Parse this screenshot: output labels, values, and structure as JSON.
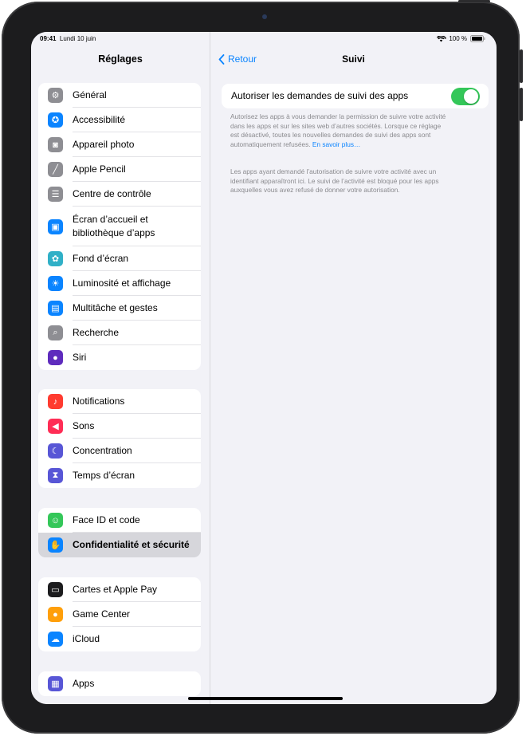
{
  "status": {
    "time": "09:41",
    "date": "Lundi 10 juin",
    "battery": "100 %"
  },
  "sidebar": {
    "title": "Réglages",
    "groups": [
      [
        {
          "label": "Général",
          "icon": "gear-icon",
          "color": "#8e8e93"
        },
        {
          "label": "Accessibilité",
          "icon": "accessibility-icon",
          "color": "#0a84ff"
        },
        {
          "label": "Appareil photo",
          "icon": "camera-icon",
          "color": "#8e8e93"
        },
        {
          "label": "Apple Pencil",
          "icon": "pencil-icon",
          "color": "#8e8e93"
        },
        {
          "label": "Centre de contrôle",
          "icon": "toggles-icon",
          "color": "#8e8e93"
        },
        {
          "label_line1": "Écran d’accueil et",
          "label_line2": "bibliothèque d’apps",
          "icon": "home-screen-icon",
          "color": "#0a84ff"
        },
        {
          "label": "Fond d’écran",
          "icon": "flower-icon",
          "color": "#30b0c7"
        },
        {
          "label": "Luminosité et affichage",
          "icon": "sun-icon",
          "color": "#0a84ff"
        },
        {
          "label": "Multitâche et gestes",
          "icon": "multitask-icon",
          "color": "#0a84ff"
        },
        {
          "label": "Recherche",
          "icon": "search-icon",
          "color": "#8e8e93"
        },
        {
          "label": "Siri",
          "icon": "siri-icon",
          "color": "#5e2bbd"
        }
      ],
      [
        {
          "label": "Notifications",
          "icon": "bell-icon",
          "color": "#ff3b30"
        },
        {
          "label": "Sons",
          "icon": "speaker-icon",
          "color": "#ff2d55"
        },
        {
          "label": "Concentration",
          "icon": "moon-icon",
          "color": "#5856d6"
        },
        {
          "label": "Temps d’écran",
          "icon": "hourglass-icon",
          "color": "#5856d6"
        }
      ],
      [
        {
          "label": "Face ID et code",
          "icon": "faceid-icon",
          "color": "#34c759"
        },
        {
          "label": "Confidentialité et sécurité",
          "icon": "hand-icon",
          "color": "#0a84ff",
          "selected": true
        }
      ],
      [
        {
          "label": "Cartes et Apple Pay",
          "icon": "wallet-icon",
          "color": "#1c1c1e"
        },
        {
          "label": "Game Center",
          "icon": "game-center-icon",
          "color": "#ff9f0a"
        },
        {
          "label": "iCloud",
          "icon": "cloud-icon",
          "color": "#0a84ff"
        }
      ],
      [
        {
          "label": "Apps",
          "icon": "apps-grid-icon",
          "color": "#5856d6"
        }
      ]
    ]
  },
  "detail": {
    "back_label": "Retour",
    "title": "Suivi",
    "toggle_label": "Autoriser les demandes de suivi des apps",
    "toggle_on": true,
    "footer1_lines": [
      "Autorisez les apps à vous demander la permission de suivre votre activité",
      "dans les apps et sur les sites web d’autres sociétés. Lorsque ce réglage",
      "est désactivé, toutes les nouvelles demandes de suivi des apps sont"
    ],
    "footer1_tail": "automatiquement refusées.",
    "footer1_link": "En savoir plus…",
    "footer2_lines": [
      "Les apps ayant demandé l’autorisation de suivre votre activité avec un",
      "identifiant apparaîtront ici. Le suivi de l’activité est bloqué pour les apps",
      "auxquelles vous avez refusé de donner votre autorisation."
    ]
  }
}
